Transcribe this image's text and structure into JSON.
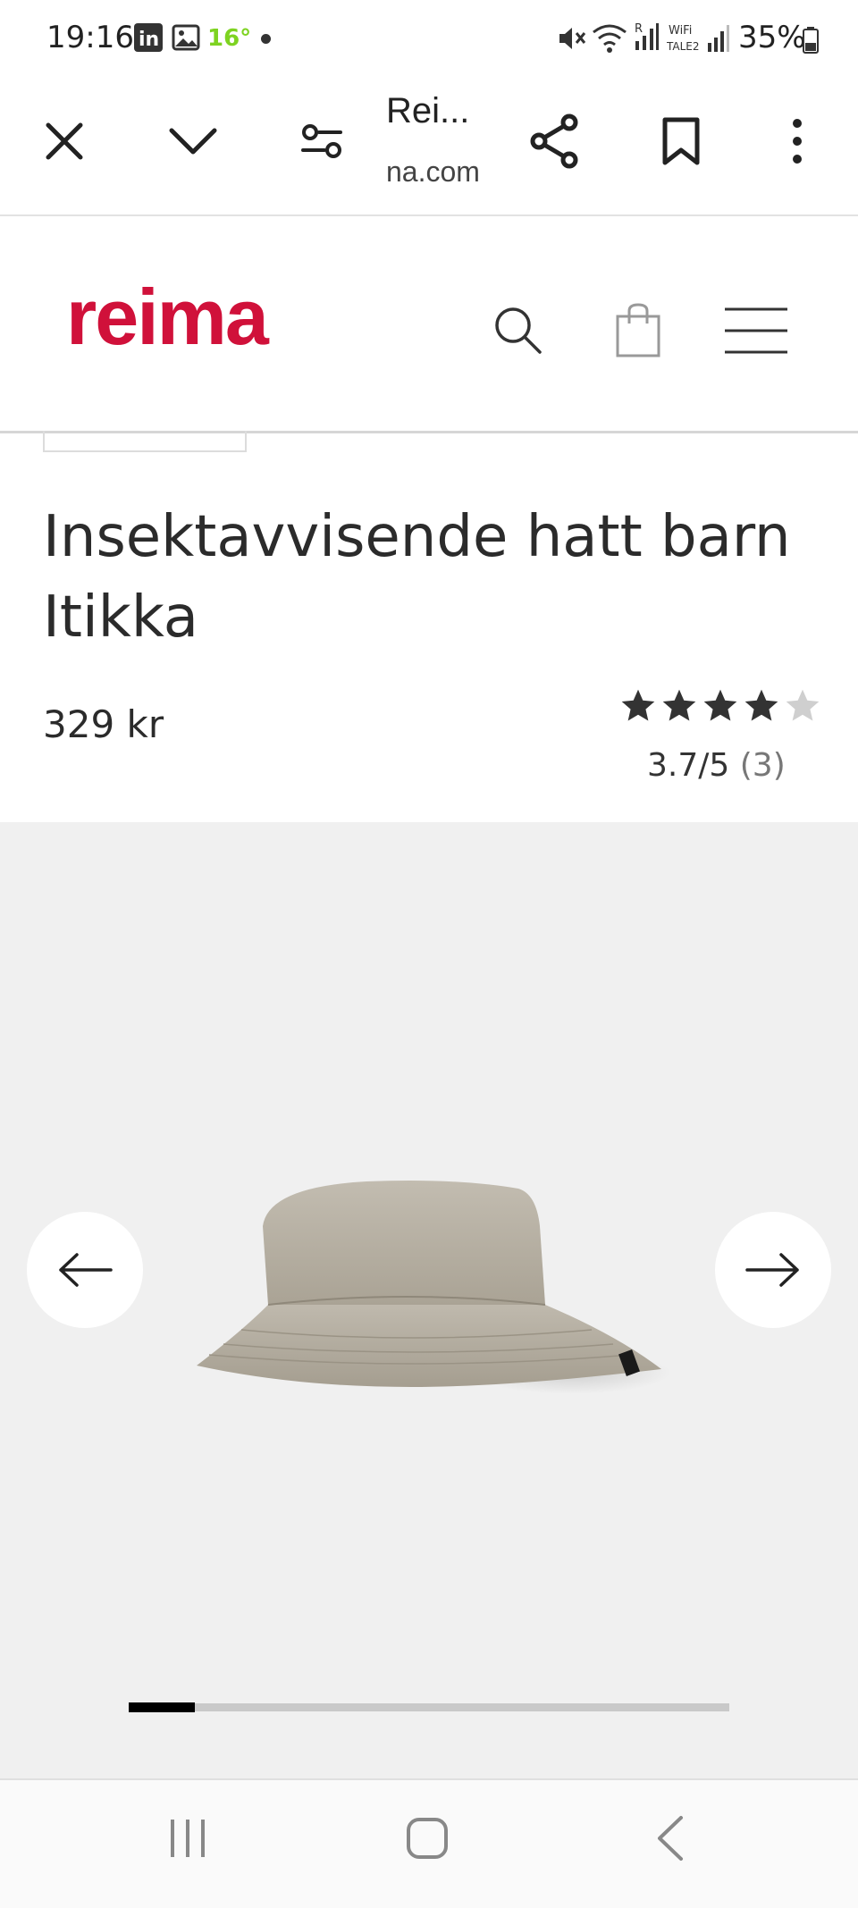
{
  "status_bar": {
    "time": "19:16",
    "temperature": "16°",
    "battery": "35%"
  },
  "browser": {
    "tab_title": "Rei...",
    "url": "na.com",
    "icons": [
      "close-icon",
      "chevron-down-icon",
      "tab-settings-icon",
      "share-icon",
      "bookmark-icon",
      "more-vert-icon"
    ]
  },
  "site": {
    "logo": "reima",
    "brand_color": "#d0113a",
    "icons": [
      "search-icon",
      "shopping-bag-icon",
      "hamburger-menu-icon"
    ]
  },
  "product": {
    "title": "Insektavvisende hatt barn Itikka",
    "price": "329 kr",
    "rating_text": "3.7/5",
    "rating_count": "(3)",
    "rating_value": 3.7,
    "rating_max": 5
  },
  "gallery": {
    "background": "#f0f0f0",
    "image": "bucket-hat-beige",
    "progress": 0.11,
    "icons": [
      "arrow-left-icon",
      "arrow-right-icon"
    ]
  },
  "system_nav": {
    "icons": [
      "recent-apps-icon",
      "home-icon",
      "back-icon"
    ]
  }
}
